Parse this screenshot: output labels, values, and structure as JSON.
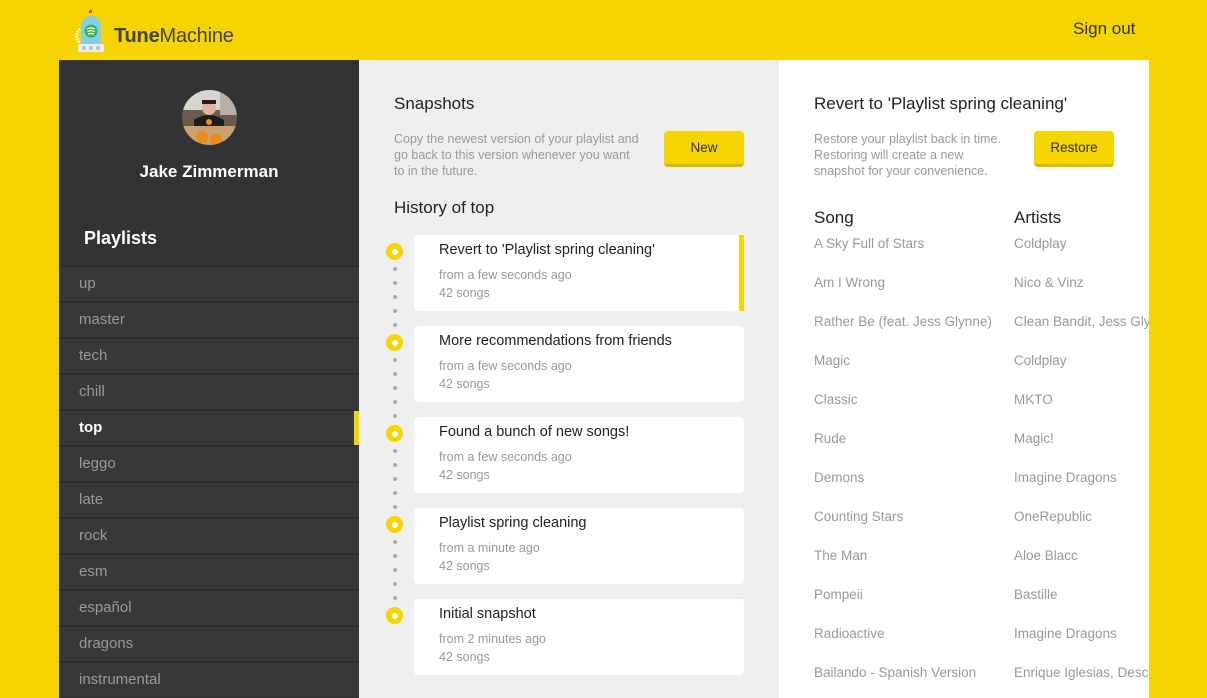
{
  "app": {
    "brand_bold": "Tune",
    "brand_light": "Machine",
    "sign_out": "Sign out",
    "accent": "#f5d400"
  },
  "sidebar": {
    "user_name": "Jake Zimmerman",
    "playlists_title": "Playlists",
    "playlists": [
      {
        "label": "up",
        "active": false
      },
      {
        "label": "master",
        "active": false
      },
      {
        "label": "tech",
        "active": false
      },
      {
        "label": "chill",
        "active": false
      },
      {
        "label": "top",
        "active": true
      },
      {
        "label": "leggo",
        "active": false
      },
      {
        "label": "late",
        "active": false
      },
      {
        "label": "rock",
        "active": false
      },
      {
        "label": "esm",
        "active": false
      },
      {
        "label": "español",
        "active": false
      },
      {
        "label": "dragons",
        "active": false
      },
      {
        "label": "instrumental",
        "active": false
      }
    ]
  },
  "snapshots": {
    "title": "Snapshots",
    "description": "Copy the newest version of your playlist and go back to this version whenever you want to in the future.",
    "new_button": "New",
    "history_title": "History of top",
    "items": [
      {
        "title": "Revert to 'Playlist spring cleaning'",
        "time": "from a few seconds ago",
        "count": "42 songs",
        "selected": true
      },
      {
        "title": "More recommendations from friends",
        "time": "from a few seconds ago",
        "count": "42 songs",
        "selected": false
      },
      {
        "title": "Found a bunch of new songs!",
        "time": "from a few seconds ago",
        "count": "42 songs",
        "selected": false
      },
      {
        "title": "Playlist spring cleaning",
        "time": "from a minute ago",
        "count": "42 songs",
        "selected": false
      },
      {
        "title": "Initial snapshot",
        "time": "from 2 minutes ago",
        "count": "42 songs",
        "selected": false
      }
    ]
  },
  "detail": {
    "title": "Revert to 'Playlist spring cleaning'",
    "description": "Restore your playlist back in time. Restoring will create a new snapshot for your convenience.",
    "restore_button": "Restore",
    "columns": {
      "song": "Song",
      "artists": "Artists"
    },
    "songs": [
      {
        "song": "A Sky Full of Stars",
        "artist": "Coldplay"
      },
      {
        "song": "Am I Wrong",
        "artist": "Nico & Vinz"
      },
      {
        "song": "Rather Be (feat. Jess Glynne)",
        "artist": "Clean Bandit, Jess Glynne"
      },
      {
        "song": "Magic",
        "artist": "Coldplay"
      },
      {
        "song": "Classic",
        "artist": "MKTO"
      },
      {
        "song": "Rude",
        "artist": "Magic!"
      },
      {
        "song": "Demons",
        "artist": "Imagine Dragons"
      },
      {
        "song": "Counting Stars",
        "artist": "OneRepublic"
      },
      {
        "song": "The Man",
        "artist": "Aloe Blacc"
      },
      {
        "song": "Pompeii",
        "artist": "Bastille"
      },
      {
        "song": "Radioactive",
        "artist": "Imagine Dragons"
      },
      {
        "song": "Bailando - Spanish Version",
        "artist": "Enrique Iglesias, Descemer Bueno"
      }
    ]
  }
}
